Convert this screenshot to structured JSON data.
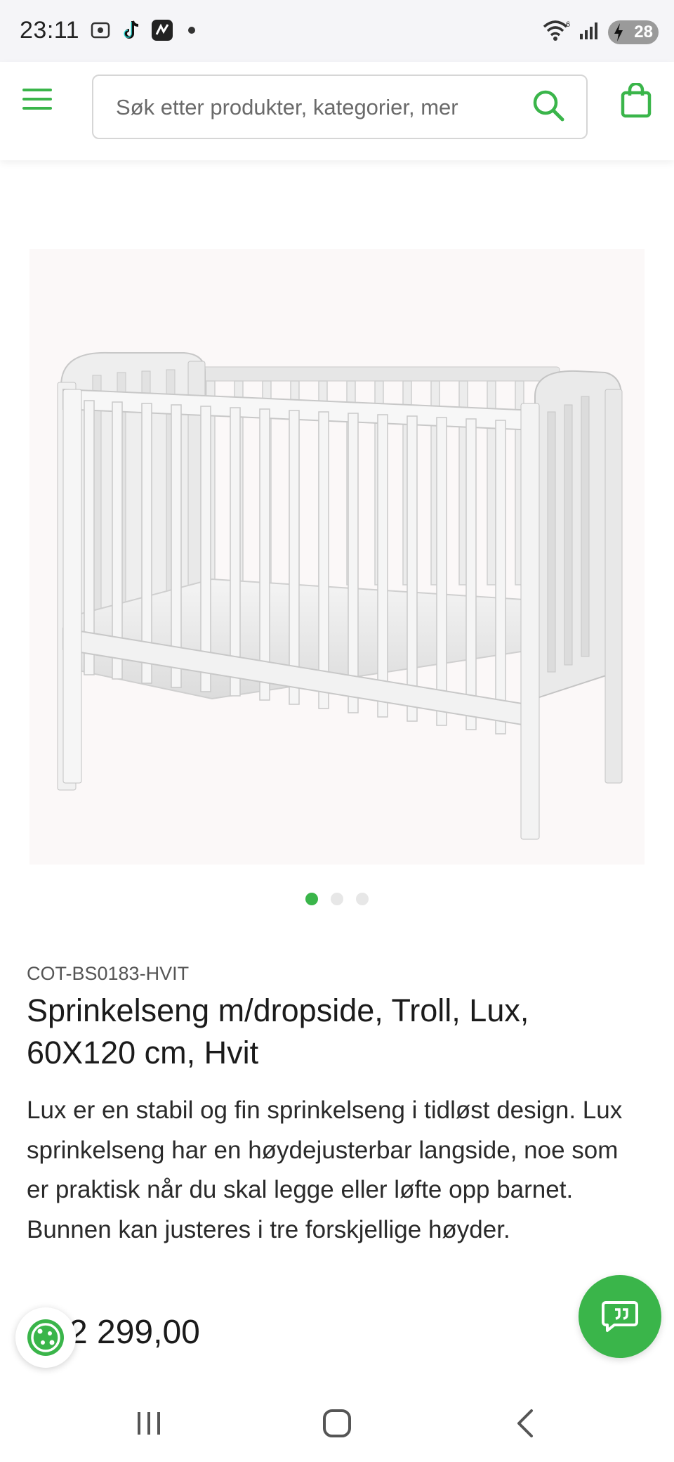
{
  "status_bar": {
    "time": "23:11",
    "battery_level": "28",
    "wifi_label": "6"
  },
  "header": {
    "search_placeholder": "Søk etter produkter, kategorier, mer",
    "icons": [
      "menu-icon",
      "search-icon",
      "shopping-bag-icon"
    ]
  },
  "gallery": {
    "image_count": 3,
    "active_index": 0
  },
  "product": {
    "sku": "COT-BS0183-HVIT",
    "title": "Sprinkelseng m/dropside, Troll, Lux, 60X120 cm, Hvit",
    "description": "Lux er en stabil og fin sprinkelseng i tidløst design. Lux sprinkelseng har en høydejusterbar langside, noe som er praktisk når du skal legge eller løfte opp barnet. Bunnen kan justeres i tre forskjellige høyder.",
    "price": "2 299,00"
  },
  "colors": {
    "accent": "#3ab54a",
    "status_bg": "#f5f5f8",
    "text": "#1f1f1f"
  }
}
